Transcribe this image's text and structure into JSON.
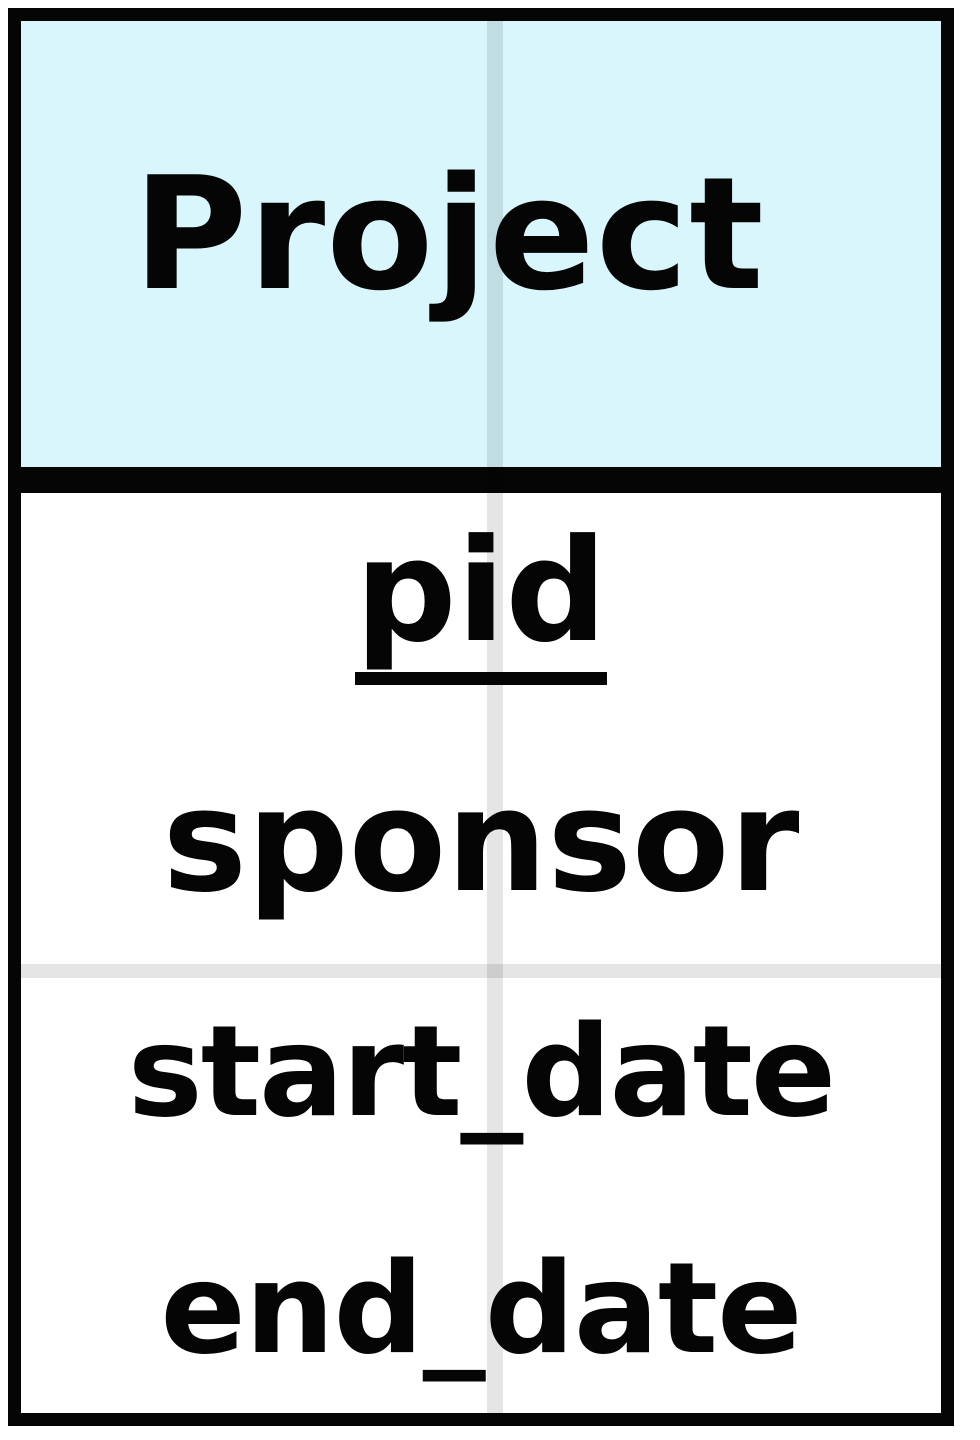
{
  "entity": {
    "name": "Project",
    "header_color": "#d9f6fc",
    "border_color": "#050505",
    "attributes": [
      {
        "name": "pid",
        "primary_key": true
      },
      {
        "name": "sponsor",
        "primary_key": false
      },
      {
        "name": "start_date",
        "primary_key": false
      },
      {
        "name": "end_date",
        "primary_key": false
      }
    ]
  }
}
